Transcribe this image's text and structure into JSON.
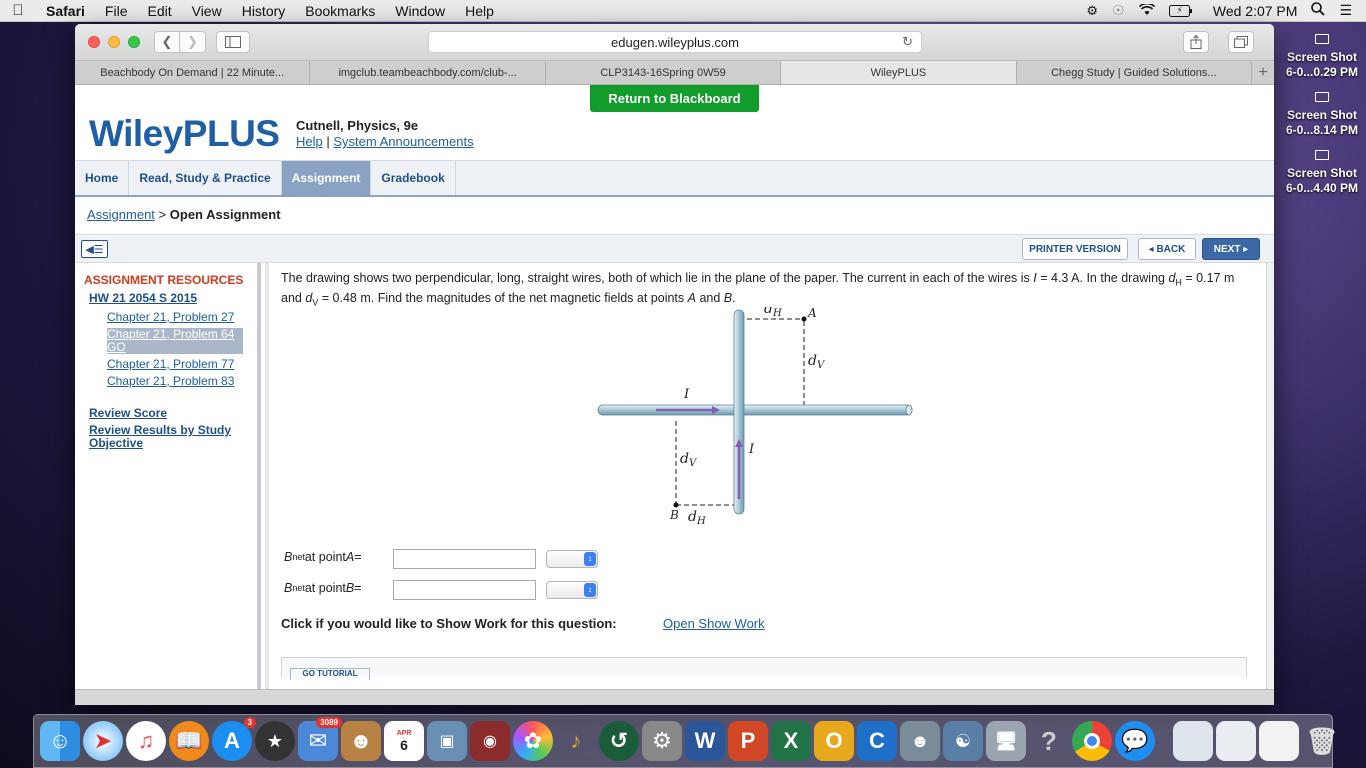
{
  "menubar": {
    "apple": "",
    "app": "Safari",
    "items": [
      "File",
      "Edit",
      "View",
      "History",
      "Bookmarks",
      "Window",
      "Help"
    ],
    "clock": "Wed 2:07 PM",
    "battery": "⚡"
  },
  "desktop": [
    {
      "line1": "Screen Shot",
      "line2": "6-0...0.29 PM"
    },
    {
      "line1": "Screen Shot",
      "line2": "6-0...8.14 PM"
    },
    {
      "line1": "Screen Shot",
      "line2": "6-0...4.40 PM"
    }
  ],
  "browser": {
    "url": "edugen.wileyplus.com",
    "tabs": [
      "Beachbody On Demand | 22 Minute...",
      "imgclub.teambeachbody.com/club-...",
      "CLP3143-16Spring 0W59",
      "WileyPLUS",
      "Chegg Study | Guided Solutions..."
    ],
    "active_tab": 3
  },
  "page": {
    "return_label": "Return to Blackboard",
    "logo": "WileyPLUS",
    "course_title": "Cutnell, Physics, 9e",
    "help_link": "Help",
    "separator": "|",
    "announcements_link": "System Announcements",
    "nav": [
      "Home",
      "Read, Study & Practice",
      "Assignment",
      "Gradebook"
    ],
    "active_nav": 2,
    "breadcrumb": {
      "link": "Assignment",
      "sep": ">",
      "current": "Open Assignment"
    },
    "actions": {
      "printer": "PRINTER VERSION",
      "back": "◂ BACK",
      "next": "NEXT ▸"
    },
    "left": {
      "title": "ASSIGNMENT RESOURCES",
      "hw": "HW 21 2054 S 2015",
      "chapters": [
        "Chapter 21, Problem 27",
        "Chapter 21, Problem 64 GO",
        "Chapter 21, Problem 77",
        "Chapter 21, Problem 83"
      ],
      "selected_chapter": 1,
      "review_score": "Review Score",
      "review_results": "Review Results by Study Objective"
    },
    "question": {
      "t1": "The drawing shows two perpendicular, long, straight wires, both of which lie in the plane of the paper. The current in each of the wires is ",
      "i_sym": "I",
      "t2": " = 4.3 A. In the drawing ",
      "dh_sym": "d",
      "dh_sub": "H",
      "t3": " = 0.17 m and ",
      "dv_sym": "d",
      "dv_sub": "V",
      "t4": " = 0.48 m. Find the magnitudes of the net magnetic fields at points ",
      "a": "A",
      "and": " and ",
      "b": "B",
      "end": "."
    },
    "diagram": {
      "label_dh": "d",
      "sub_h": "H",
      "label_dv": "d",
      "sub_v": "V",
      "label_i": "I",
      "label_a": "A",
      "label_b": "B"
    },
    "answers": [
      {
        "b": "B",
        "sub": "net",
        "text": " at point ",
        "pt": "A",
        "eq": " ="
      },
      {
        "b": "B",
        "sub": "net",
        "text": " at point ",
        "pt": "B",
        "eq": " ="
      }
    ],
    "show_work_text": "Click if you would like to Show Work for this question:",
    "show_work_link": "Open Show Work",
    "tutorial": "GO TUTORIAL"
  },
  "dock": {
    "calendar_month": "APR",
    "calendar_day": "6",
    "mail_badge": "3089",
    "appstore_badge": "3",
    "help_glyph": "?"
  }
}
